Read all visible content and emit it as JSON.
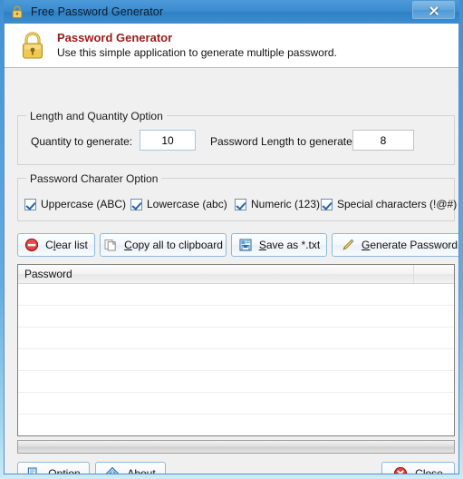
{
  "window": {
    "title": "Free Password Generator",
    "title_icon": "padlock-icon",
    "close_button_label": "X"
  },
  "banner": {
    "icon": "padlock-icon",
    "title": "Password Generator",
    "subtitle": "Use this simple application to generate multiple password.",
    "title_color": "#9b1b1b"
  },
  "length_group": {
    "legend": "Length and Quantity Option",
    "quantity_label": "Quantity to generate:",
    "quantity_value": "10",
    "password_length_label": "Password Length to generate:",
    "password_length_value": "8"
  },
  "charset_group": {
    "legend": "Password Charater Option",
    "options": [
      {
        "label": "Uppercase (ABC)",
        "checked": true
      },
      {
        "label": "Lowercase (abc)",
        "checked": true
      },
      {
        "label": "Numeric (123)",
        "checked": true
      },
      {
        "label": "Special characters (!@#)",
        "checked": true
      }
    ]
  },
  "toolbar": {
    "buttons": [
      {
        "name": "clear-list",
        "icon": "no-entry-icon",
        "pre": "C",
        "accel": "l",
        "post": "ear list"
      },
      {
        "name": "copy-all-to-clipboard",
        "icon": "copy-icon",
        "pre": "",
        "accel": "C",
        "post": "opy all to clipboard"
      },
      {
        "name": "save-as-txt",
        "icon": "save-disk-icon",
        "pre": "",
        "accel": "S",
        "post": "ave as *.txt"
      },
      {
        "name": "generate-password",
        "icon": "pencil-icon",
        "pre": "",
        "accel": "G",
        "post": "enerate Password"
      }
    ]
  },
  "list": {
    "column_header": "Password",
    "rows": []
  },
  "footer": {
    "option": {
      "icon": "properties-icon",
      "pre": "O",
      "accel": "p",
      "post": "tion"
    },
    "about": {
      "icon": "info-diamond-icon",
      "pre": "",
      "accel": "A",
      "post": "bout"
    },
    "close": {
      "icon": "red-x-circle-icon",
      "pre": "",
      "accel": "C",
      "post": "lose"
    }
  },
  "colors": {
    "accent": "#3b8ccf",
    "banner_title": "#9b1b1b",
    "frame": "#c9ecf8"
  }
}
